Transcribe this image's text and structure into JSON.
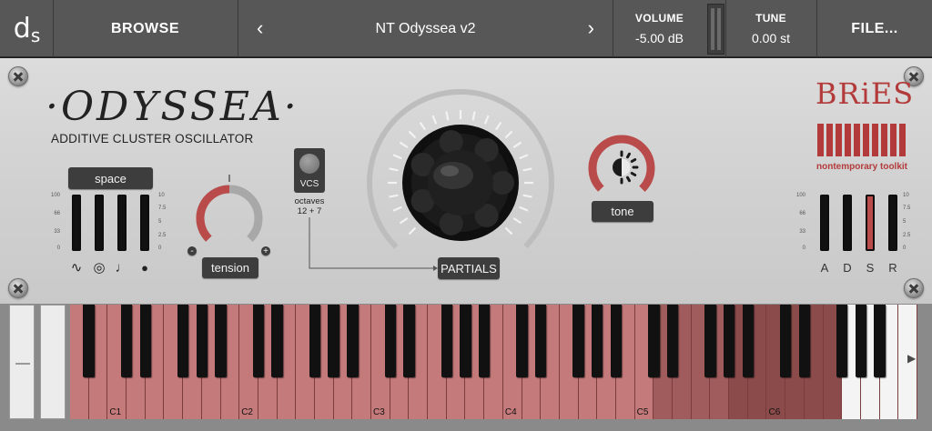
{
  "header": {
    "logo": "d",
    "logo_sub": "S",
    "browse": "BROWSE",
    "preset_name": "NT Odyssea v2",
    "prev_icon": "chevron-left-icon",
    "next_icon": "chevron-right-icon",
    "volume_label": "VOLUME",
    "volume_value": "-5.00 dB",
    "tune_label": "TUNE",
    "tune_value": "0.00 st",
    "file": "FILE..."
  },
  "brand": {
    "title": "·ODYSSEA·",
    "subtitle": "ADDITIVE CLUSTER OSCILLATOR"
  },
  "space": {
    "label": "space",
    "scale": [
      "100",
      "66",
      "33",
      "0"
    ],
    "scale_right": [
      "10",
      "7.5",
      "5",
      "2.5",
      "0"
    ],
    "icons": [
      "sine-wave-icon",
      "circle-target-icon",
      "note-icon",
      "drop-icon"
    ],
    "levels": [
      0,
      0,
      0,
      0
    ]
  },
  "tension": {
    "label": "tension",
    "minus": "-",
    "plus": "+",
    "value": 0.5
  },
  "vcs": {
    "label": "VCS",
    "octaves_line1": "octaves",
    "octaves_line2": "12 + 7"
  },
  "partials": {
    "label": "PARTIALS"
  },
  "tone": {
    "label": "tone",
    "icon": "sun-brightness-icon",
    "value": 1.0
  },
  "bries": {
    "word": "BRiES",
    "tagline": "nontemporary toolkit"
  },
  "adsr": {
    "letters": [
      "A",
      "D",
      "S",
      "R"
    ],
    "scale_left": [
      "100",
      "66",
      "33",
      "0"
    ],
    "scale_right": [
      "10",
      "7.5",
      "5",
      "2.5",
      "0"
    ],
    "levels": [
      0,
      0,
      1.0,
      0
    ]
  },
  "keyboard": {
    "octave_labels": [
      "C1",
      "C2",
      "C3",
      "C4",
      "C5",
      "C6"
    ],
    "left_arrow": "◀",
    "right_arrow": "▶"
  },
  "colors": {
    "accent_red": "#b94b4b",
    "key_tint": "#c47a7a",
    "key_dark_tint": "#8b4b4b",
    "dark_bg": "#575757"
  }
}
